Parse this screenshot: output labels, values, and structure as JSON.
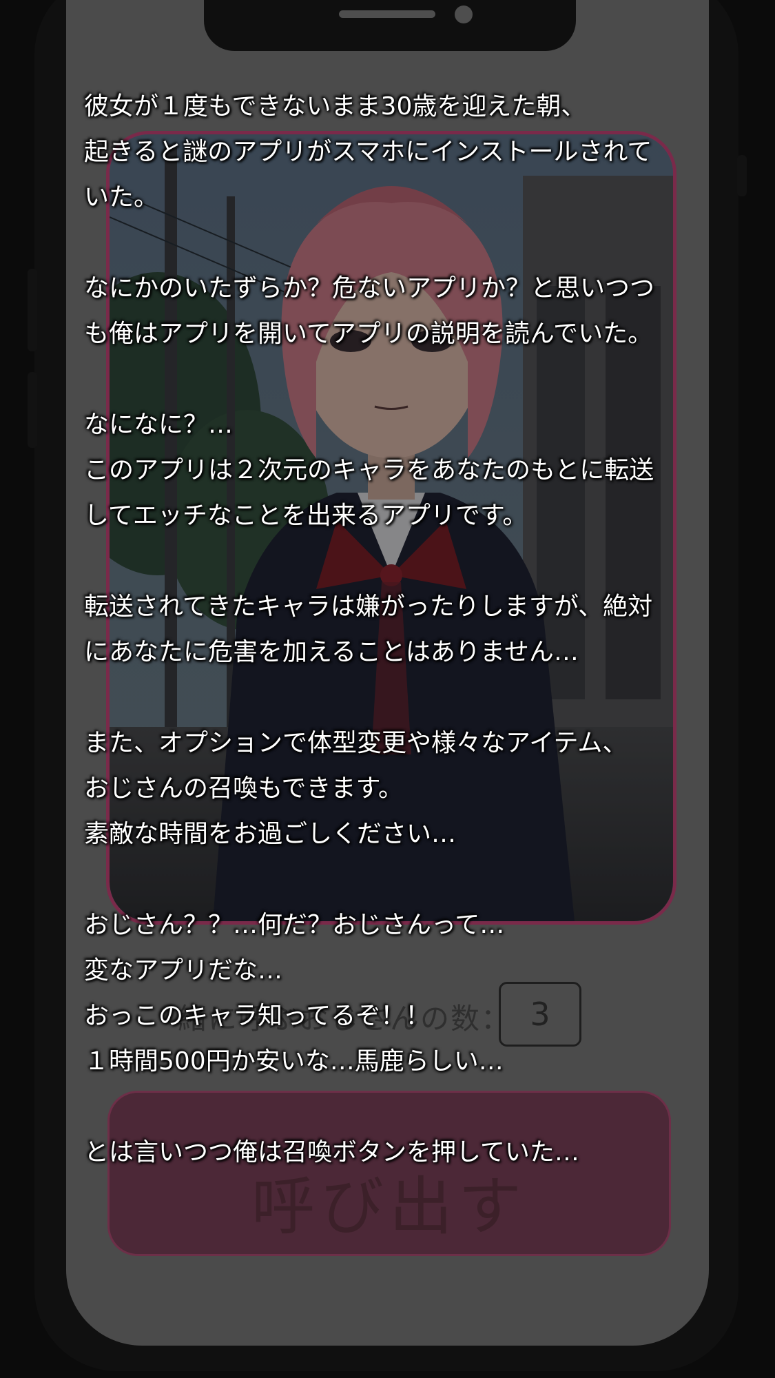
{
  "story": {
    "lines": [
      "彼女が１度もできないまま30歳を迎えた朝、",
      "起きると謎のアプリがスマホにインストールされて",
      "いた。",
      "",
      "なにかのいたずらか？危ないアプリか？と思いつつ",
      "も俺はアプリを開いてアプリの説明を読んでいた。",
      "",
      "なになに？…",
      "このアプリは２次元のキャラをあなたのもとに転送",
      "してエッチなことを出来るアプリです。",
      "",
      "転送されてきたキャラは嫌がったりしますが、絶対",
      "にあなたに危害を加えることはありません…",
      "",
      "また、オプションで体型変更や様々なアイテム、",
      "おじさんの召喚もできます。",
      "素敵な時間をお過ごしください…",
      "",
      "おじさん？？…何だ？おじさんって…",
      "変なアプリだな…",
      "おっこのキャラ知ってるぞ！！",
      "１時間500円か安いな…馬鹿らしい…",
      "",
      "とは言いつつ俺は召喚ボタンを押していた…"
    ]
  },
  "app": {
    "count_label": "緒に呼ぶおじさんの数：",
    "count_value": "3",
    "summon_button": "呼び出す"
  },
  "colors": {
    "screen_bg": "#4b4b4b",
    "frame_bg": "#101010",
    "card_border": "#7a2a4a",
    "button_bg": "#4c2837",
    "text": "#ffffff"
  }
}
